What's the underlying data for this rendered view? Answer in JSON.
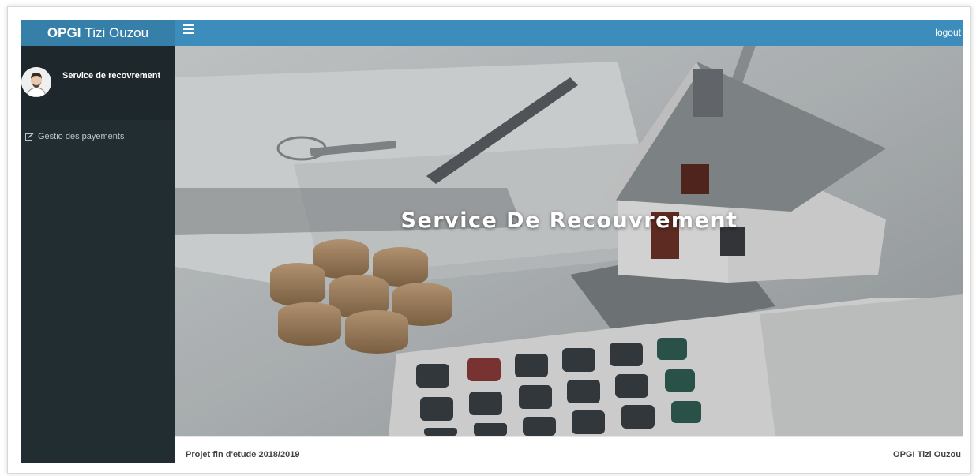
{
  "header": {
    "brand_bold": "OPGI",
    "brand_rest": "Tizi Ouzou",
    "logout_label": "logout"
  },
  "sidebar": {
    "user_name": "Service de recovrement",
    "items": [
      {
        "label": "Gestio des payements",
        "icon": "edit-icon"
      }
    ]
  },
  "main": {
    "hero_title": "Service De Recouvrement"
  },
  "footer": {
    "left": "Projet fin d'etude 2018/2019",
    "right": "OPGI Tizi Ouzou"
  },
  "colors": {
    "topbar": "#3c8dbc",
    "brand_bg": "#367fa9",
    "sidebar_bg": "#222d32",
    "sidebar_panel": "#1e282c",
    "sidebar_text": "#b8c7ce"
  }
}
